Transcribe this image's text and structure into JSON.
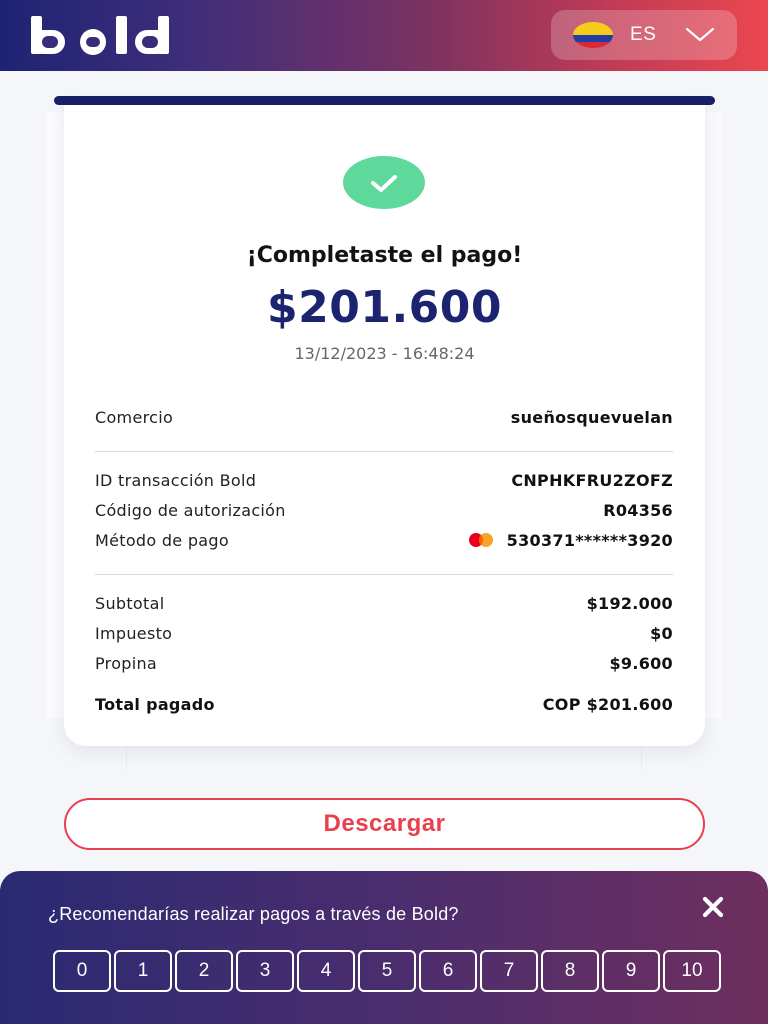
{
  "header": {
    "language": "ES",
    "colors": {
      "gradient_start": "#1e2374",
      "gradient_end": "#ea4750"
    }
  },
  "receipt": {
    "status_icon": "check-icon",
    "title": "¡Completaste el pago!",
    "amount": "$201.600",
    "datetime": "13/12/2023 - 16:48:24",
    "merchant": {
      "label": "Comercio",
      "value": "sueñosquevuelan"
    },
    "details": [
      {
        "label": "ID transacción Bold",
        "value": "CNPHKFRU2ZOFZ"
      },
      {
        "label": "Código de autorización",
        "value": "R04356"
      },
      {
        "label": "Método de pago",
        "value": "530371******3920"
      }
    ],
    "summary": [
      {
        "label": "Subtotal",
        "value": "$192.000"
      },
      {
        "label": "Impuesto",
        "value": "$0"
      },
      {
        "label": "Propina",
        "value": "$9.600"
      }
    ],
    "total": {
      "label": "Total pagado",
      "value": "COP $201.600"
    }
  },
  "actions": {
    "download": "Descargar"
  },
  "survey": {
    "question": "¿Recomendarías realizar pagos a través de Bold?",
    "options": [
      "0",
      "1",
      "2",
      "3",
      "4",
      "5",
      "6",
      "7",
      "8",
      "9",
      "10"
    ]
  }
}
